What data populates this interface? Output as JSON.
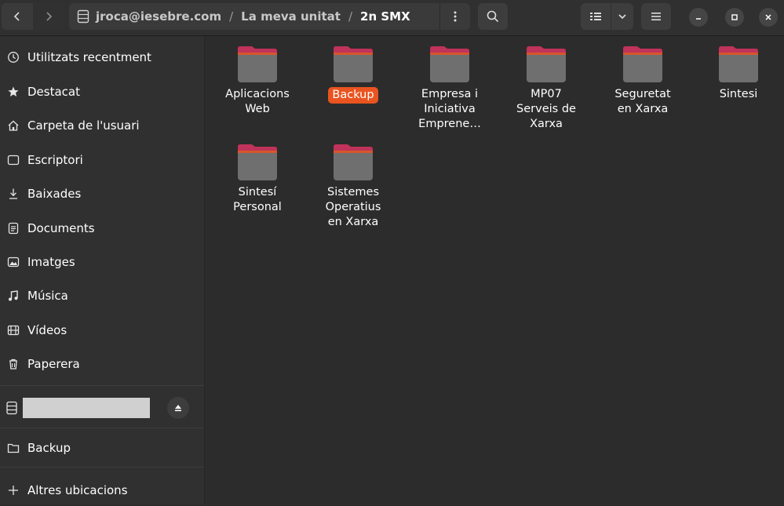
{
  "path": {
    "segments": [
      "jroca@iesebre.com",
      "La meva unitat",
      "2n SMX"
    ],
    "separator": "/"
  },
  "sidebar": {
    "items": [
      {
        "label": "Utilitzats recentment",
        "icon": "clock-icon"
      },
      {
        "label": "Destacat",
        "icon": "star-icon"
      },
      {
        "label": "Carpeta de l'usuari",
        "icon": "home-icon"
      },
      {
        "label": "Escriptori",
        "icon": "desktop-icon"
      },
      {
        "label": "Baixades",
        "icon": "download-icon"
      },
      {
        "label": "Documents",
        "icon": "document-icon"
      },
      {
        "label": "Imatges",
        "icon": "image-icon"
      },
      {
        "label": "Música",
        "icon": "music-icon"
      },
      {
        "label": "Vídeos",
        "icon": "video-icon"
      },
      {
        "label": "Paperera",
        "icon": "trash-icon"
      }
    ],
    "bookmark": {
      "label": "Backup",
      "icon": "folder-icon"
    },
    "other_locations": {
      "label": "Altres ubicacions",
      "icon": "plus-icon"
    }
  },
  "files": [
    {
      "line1": "Aplicacions",
      "line2": "Web",
      "line3": "",
      "selected": false
    },
    {
      "line1": "Backup",
      "line2": "",
      "line3": "",
      "selected": true
    },
    {
      "line1": "Empresa i",
      "line2": "Iniciativa",
      "line3": "Emprene…",
      "selected": false
    },
    {
      "line1": "MP07",
      "line2": "Serveis de",
      "line3": "Xarxa",
      "selected": false
    },
    {
      "line1": "Seguretat",
      "line2": "en Xarxa",
      "line3": "",
      "selected": false
    },
    {
      "line1": "Sintesi",
      "line2": "",
      "line3": "",
      "selected": false
    },
    {
      "line1": "Sintesí",
      "line2": "Personal",
      "line3": "",
      "selected": false
    },
    {
      "line1": "Sistemes",
      "line2": "Operatius",
      "line3": "en Xarxa",
      "selected": false
    }
  ],
  "colors": {
    "accent": "#e95420",
    "folder_top": "#c0335b",
    "folder_body": "#707070",
    "background": "#2c2c2c",
    "sidebar": "#303030"
  }
}
